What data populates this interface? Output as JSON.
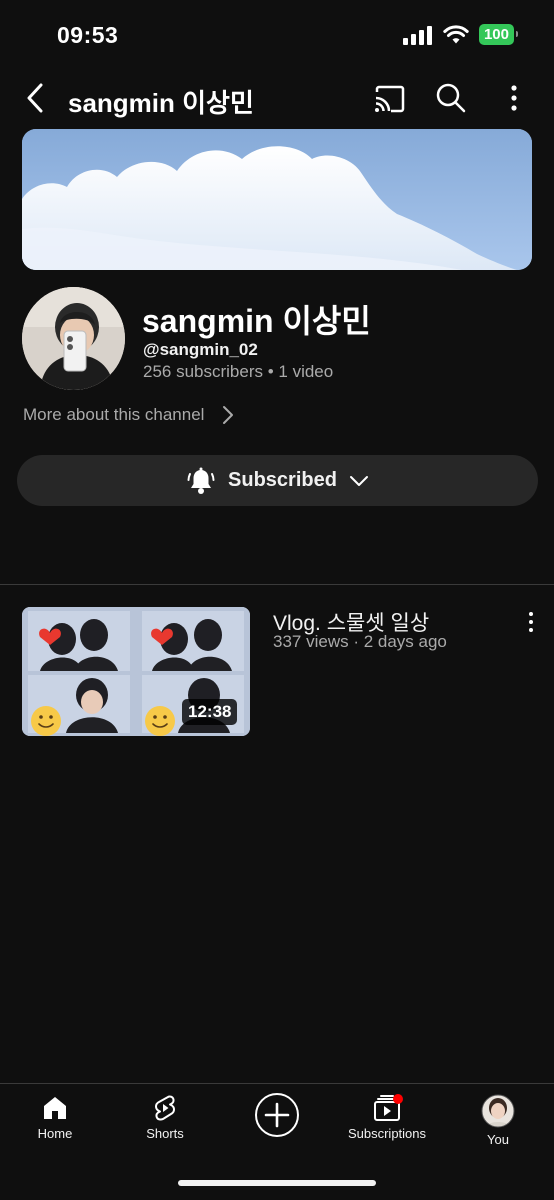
{
  "status_bar": {
    "time": "09:53",
    "battery": "100"
  },
  "topbar": {
    "title": "sangmin 이상민"
  },
  "channel": {
    "name": "sangmin 이상민",
    "handle": "@sangmin_02",
    "stats": "256 subscribers • 1 video",
    "more_about": "More about this channel"
  },
  "subscribe": {
    "label": "Subscribed"
  },
  "videos": [
    {
      "title": "Vlog. 스물셋 일상",
      "meta": "337 views · 2 days ago",
      "duration": "12:38"
    }
  ],
  "bottom_nav": {
    "home": "Home",
    "shorts": "Shorts",
    "subscriptions": "Subscriptions",
    "you": "You"
  },
  "icons": {
    "back": "chevron-left-icon",
    "cast": "cast-icon",
    "search": "search-icon",
    "more": "more-vertical-icon",
    "bell": "bell-icon",
    "chevron_down": "chevron-down-icon",
    "chevron_right": "chevron-right-icon",
    "home": "home-icon",
    "shorts": "shorts-icon",
    "create": "plus-circle-icon",
    "subscriptions": "subscriptions-icon"
  },
  "colors": {
    "background": "#0f0f0f",
    "surface": "#272727",
    "secondary_text": "#aaaaaa",
    "battery": "#34c759",
    "notification_dot": "#ff0000"
  }
}
